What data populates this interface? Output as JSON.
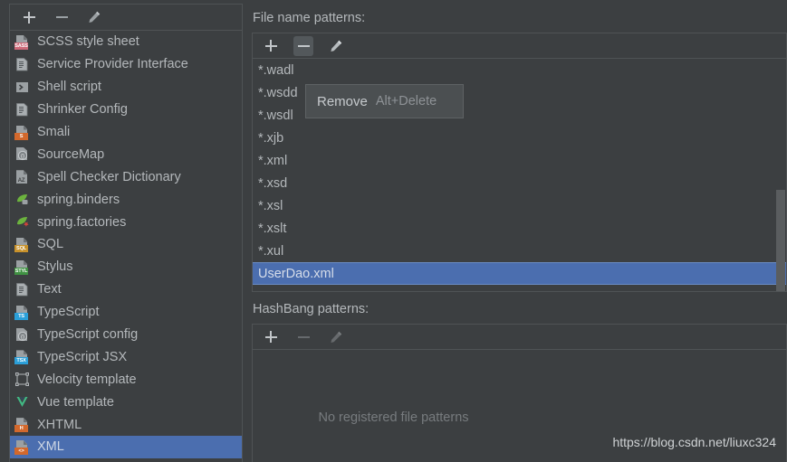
{
  "app": {
    "theme_bg": "#3c3f41",
    "accent_selection": "#4b6eaf",
    "border": "#4f5355"
  },
  "sidebar": {
    "toolbar": {
      "add_label": "+",
      "remove_label": "−",
      "edit_label": "edit"
    },
    "items": [
      {
        "label": "SCSS style sheet",
        "icon": "scss-file-icon",
        "badge": "SASS",
        "badge_color": "#cd6a79",
        "selected": false
      },
      {
        "label": "Service Provider Interface",
        "icon": "spi-file-icon",
        "badge": "",
        "badge_color": "",
        "selected": false
      },
      {
        "label": "Shell script",
        "icon": "shell-script-icon",
        "badge": "",
        "badge_color": "",
        "selected": false
      },
      {
        "label": "Shrinker Config",
        "icon": "shrinker-config-icon",
        "badge": "",
        "badge_color": "",
        "selected": false
      },
      {
        "label": "Smali",
        "icon": "smali-file-icon",
        "badge": "S",
        "badge_color": "#d2682c",
        "selected": false
      },
      {
        "label": "SourceMap",
        "icon": "sourcemap-file-icon",
        "badge": "",
        "badge_color": "",
        "selected": false
      },
      {
        "label": "Spell Checker Dictionary",
        "icon": "dictionary-file-icon",
        "badge": "AZ",
        "badge_color": "",
        "selected": false
      },
      {
        "label": "spring.binders",
        "icon": "spring-binders-icon",
        "badge": "",
        "badge_color": "#6cb33e",
        "selected": false
      },
      {
        "label": "spring.factories",
        "icon": "spring-factories-icon",
        "badge": "",
        "badge_color": "#6cb33e",
        "selected": false
      },
      {
        "label": "SQL",
        "icon": "sql-file-icon",
        "badge": "SQL",
        "badge_color": "#c8922c",
        "selected": false
      },
      {
        "label": "Stylus",
        "icon": "stylus-file-icon",
        "badge": "STYL",
        "badge_color": "#3f9142",
        "selected": false
      },
      {
        "label": "Text",
        "icon": "text-file-icon",
        "badge": "",
        "badge_color": "",
        "selected": false
      },
      {
        "label": "TypeScript",
        "icon": "typescript-file-icon",
        "badge": "TS",
        "badge_color": "#2b9fd8",
        "selected": false
      },
      {
        "label": "TypeScript config",
        "icon": "typescript-config-icon",
        "badge": "",
        "badge_color": "",
        "selected": false
      },
      {
        "label": "TypeScript JSX",
        "icon": "typescript-jsx-icon",
        "badge": "TSX",
        "badge_color": "#2b9fd8",
        "selected": false
      },
      {
        "label": "Velocity template",
        "icon": "velocity-template-icon",
        "badge": "",
        "badge_color": "",
        "selected": false
      },
      {
        "label": "Vue template",
        "icon": "vue-template-icon",
        "badge": "",
        "badge_color": "#41b883",
        "selected": false
      },
      {
        "label": "XHTML",
        "icon": "xhtml-file-icon",
        "badge": "H",
        "badge_color": "#d2682c",
        "selected": false
      },
      {
        "label": "XML",
        "icon": "xml-file-icon",
        "badge": "<>",
        "badge_color": "#d2682c",
        "selected": true
      }
    ]
  },
  "file_name_patterns": {
    "label": "File name patterns:",
    "toolbar": {
      "add_label": "+",
      "remove_label": "−",
      "edit_label": "edit"
    },
    "patterns": [
      {
        "value": "*.wadl",
        "selected": false
      },
      {
        "value": "*.wsdd",
        "selected": false
      },
      {
        "value": "*.wsdl",
        "selected": false
      },
      {
        "value": "*.xjb",
        "selected": false
      },
      {
        "value": "*.xml",
        "selected": false
      },
      {
        "value": "*.xsd",
        "selected": false
      },
      {
        "value": "*.xsl",
        "selected": false
      },
      {
        "value": "*.xslt",
        "selected": false
      },
      {
        "value": "*.xul",
        "selected": false
      },
      {
        "value": "UserDao.xml",
        "selected": true
      }
    ]
  },
  "hashbang_patterns": {
    "label": "HashBang patterns:",
    "toolbar": {
      "add_label": "+",
      "remove_label": "−",
      "edit_label": "edit"
    },
    "patterns": [],
    "empty_message": "No registered file patterns"
  },
  "tooltip": {
    "visible": true,
    "title": "Remove",
    "shortcut": "Alt+Delete"
  },
  "watermark": {
    "text": "https://blog.csdn.net/liuxc324"
  }
}
